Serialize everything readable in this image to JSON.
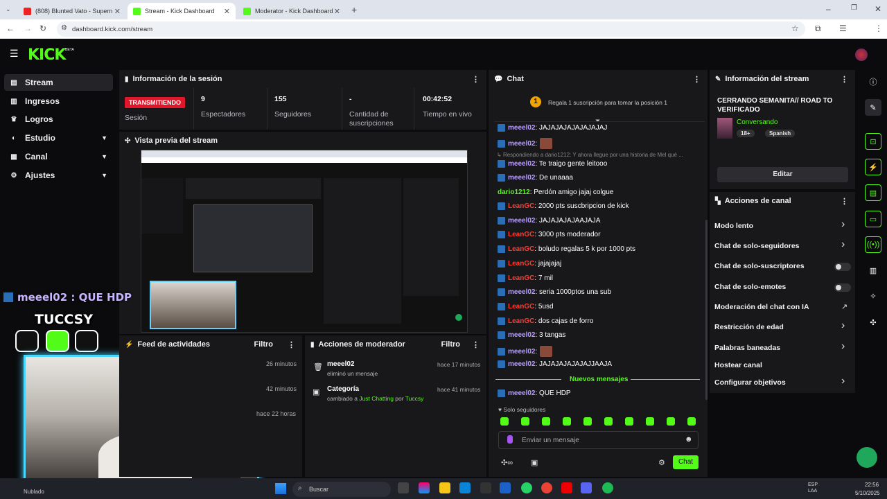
{
  "browser": {
    "tabs": [
      {
        "title": "(808) Blunted Vato - Supern",
        "fav": "#e22"
      },
      {
        "title": "Stream - Kick Dashboard",
        "fav": "#53fc18"
      },
      {
        "title": "Moderator - Kick Dashboard",
        "fav": "#53fc18"
      }
    ],
    "url": "dashboard.kick.com/stream"
  },
  "kick": {
    "logo": "KICK",
    "beta": "BETA"
  },
  "nav": {
    "items": [
      {
        "label": "Stream",
        "icon": "stream-icon"
      },
      {
        "label": "Ingresos",
        "icon": "revenue-icon"
      },
      {
        "label": "Logros",
        "icon": "trophy-icon"
      },
      {
        "label": "Estudio",
        "icon": "studio-icon"
      },
      {
        "label": "Canal",
        "icon": "channel-icon"
      },
      {
        "label": "Ajustes",
        "icon": "gear-icon"
      }
    ]
  },
  "session": {
    "title": "Información de la sesión",
    "live_badge": "TRANSMITIENDO",
    "session_label": "Sesión",
    "stats": [
      {
        "value": "9",
        "label": "Espectadores"
      },
      {
        "value": "155",
        "label": "Seguidores"
      },
      {
        "value": "-",
        "label": "Cantidad de suscripciones"
      },
      {
        "value": "00:42:52",
        "label": "Tiempo en vivo"
      }
    ]
  },
  "preview": {
    "title": "Vista previa del stream"
  },
  "overlay": {
    "chat_line": "meeel02 : QUE HDP",
    "name": "TUCCSY"
  },
  "feed": {
    "title": "Feed de actividades",
    "filter": "Filtro",
    "times": [
      "26 minutos",
      "42 minutos",
      "hace 22 horas"
    ]
  },
  "mod": {
    "title": "Acciones de moderador",
    "filter": "Filtro",
    "items": [
      {
        "user": "meeel02",
        "desc": "eliminó un mensaje",
        "time": "hace 17 minutos"
      },
      {
        "user": "Categoría",
        "desc_pre": "cambiado a ",
        "category": "Just Chatting",
        "desc_mid": " por ",
        "by": "Tuccsy",
        "time": "hace 41 minutos"
      }
    ]
  },
  "chat": {
    "title": "Chat",
    "gift": "Regala 1 suscripción para tomar la posición 1",
    "reply_to": "Respondiendo a dario1212: Y ahora llegue por una historia de Mel qué ...",
    "messages": [
      {
        "user": "meeel02",
        "text": ": JAJAJAJAJAJAJAJAJ",
        "c": "b",
        "badge": true
      },
      {
        "user": "meeel02",
        "text": ":",
        "c": "b",
        "badge": true,
        "emote": true
      },
      {
        "user": "meeel02",
        "text": ": Te traigo gente leitooo",
        "c": "b",
        "badge": true
      },
      {
        "user": "meeel02",
        "text": ": De unaaaa",
        "c": "b",
        "badge": true
      },
      {
        "user": "dario1212",
        "text": ": Perdón amigo jajaj colgue",
        "c": "g",
        "badge": false
      },
      {
        "user": "LeanGC",
        "text": ": 2000 pts suscbripcion de kick",
        "c": "r",
        "badge": true
      },
      {
        "user": "meeel02",
        "text": ": JAJAJAJAJAAJAJA",
        "c": "b",
        "badge": true
      },
      {
        "user": "LeanGC",
        "text": ": 3000 pts moderador",
        "c": "r",
        "badge": true
      },
      {
        "user": "LeanGC",
        "text": ": boludo regalas 5 k por 1000 pts",
        "c": "r",
        "badge": true
      },
      {
        "user": "LeanGC",
        "text": ": jajajajaj",
        "c": "r",
        "badge": true
      },
      {
        "user": "LeanGC",
        "text": ": 7 mil",
        "c": "r",
        "badge": true
      },
      {
        "user": "meeel02",
        "text": ": seria 1000ptos una sub",
        "c": "b",
        "badge": true
      },
      {
        "user": "LeanGC",
        "text": ": 5usd",
        "c": "r",
        "badge": true
      },
      {
        "user": "LeanGC",
        "text": ": dos cajas de forro",
        "c": "r",
        "badge": true
      },
      {
        "user": "meeel02",
        "text": ": 3 tangas",
        "c": "b",
        "badge": true
      },
      {
        "user": "meeel02",
        "text": ":",
        "c": "b",
        "badge": true,
        "emote": true
      },
      {
        "user": "meeel02",
        "text": ": JAJAJAJAJAJAJJAAJA",
        "c": "b",
        "badge": true
      }
    ],
    "new_messages": "Nuevos mensajes",
    "last": {
      "user": "meeel02",
      "text": ": QUE HDP"
    },
    "followers_only": "Solo seguidores",
    "placeholder": "Enviar un mensaje",
    "send": "Chat"
  },
  "stream_info": {
    "title": "Información del stream",
    "stream_title": "CERRANDO SEMANITA// ROAD TO VERIFICADO",
    "category": "Conversando",
    "tags": [
      "18+",
      "Spanish"
    ],
    "edit": "Editar"
  },
  "channel_actions": {
    "title": "Acciones de canal",
    "items": [
      {
        "label": "Modo lento",
        "ctrl": "chevron"
      },
      {
        "label": "Chat de solo-seguidores",
        "ctrl": "chevron"
      },
      {
        "label": "Chat de solo-suscriptores",
        "ctrl": "toggle"
      },
      {
        "label": "Chat de solo-emotes",
        "ctrl": "toggle"
      },
      {
        "label": "Moderación del chat con IA",
        "ctrl": "external"
      },
      {
        "label": "Restricción de edad",
        "ctrl": "chevron"
      },
      {
        "label": "Palabras baneadas",
        "ctrl": "chevron"
      },
      {
        "label": "Hostear canal",
        "ctrl": "none"
      },
      {
        "label": "Configurar objetivos",
        "ctrl": "chevron"
      }
    ]
  },
  "taskbar": {
    "search": "Buscar",
    "status": "Nublado",
    "lang": "ESP\nLAA",
    "time": "22:56",
    "date": "5/10/2025"
  }
}
